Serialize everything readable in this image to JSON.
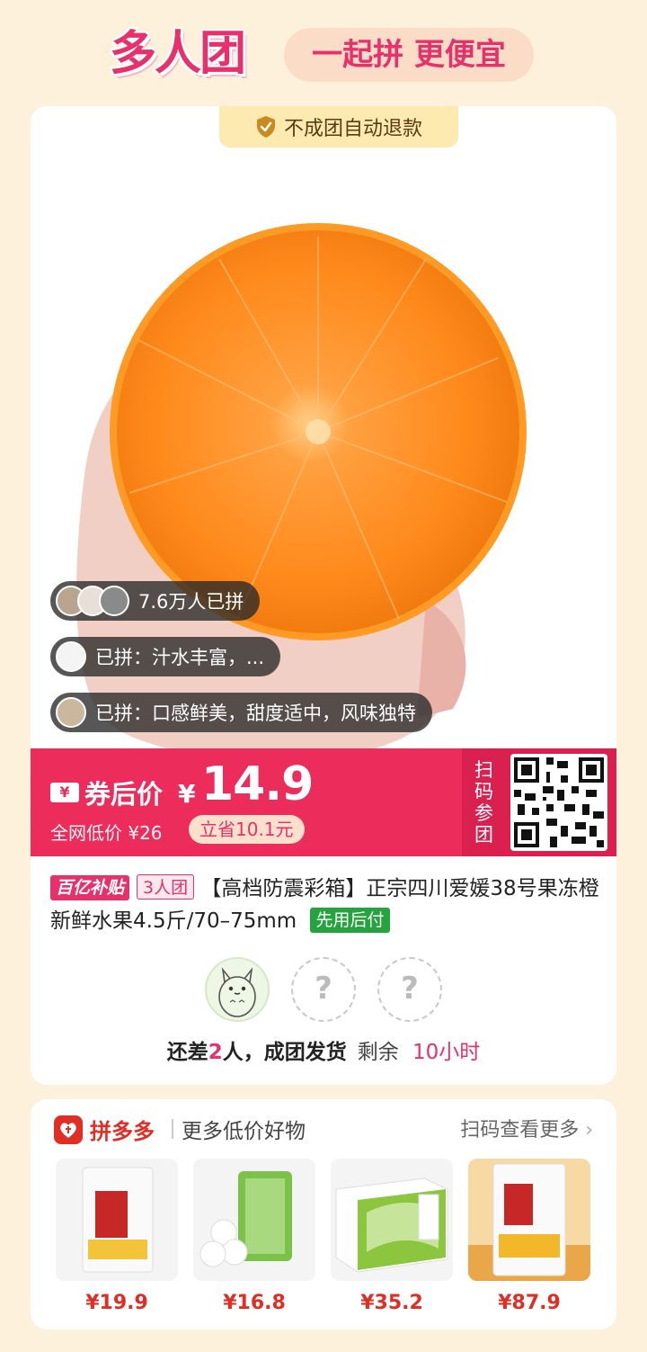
{
  "header": {
    "logo_text": "多人团",
    "slogan": "一起拼 更便宜"
  },
  "product": {
    "refund_badge": "不成团自动退款",
    "joined_count": "7.6万人已拼",
    "reviews": [
      "已拼：汁水丰富，...",
      "已拼：口感鲜美，甜度适中，风味独特"
    ],
    "coupon_icon": "¥",
    "price_label": "券后价",
    "currency": "¥",
    "price": "14.9",
    "original_price": "全网低价 ¥26",
    "saving": "立省10.1元",
    "scan_label": "扫码参团",
    "tag_subsidy": "百亿补贴",
    "tag_group": "3人团",
    "title": "【高档防震彩箱】正宗四川爱媛38号果冻橙新鲜水果4.5斤/70–75mm",
    "tag_pay_later": "先用后付"
  },
  "group": {
    "empty_slot": "?",
    "remaining_prefix": "还差",
    "remaining_count": "2",
    "remaining_suffix": "人，成团发货",
    "time_prefix": "剩余",
    "time_left": "10小时"
  },
  "recommend": {
    "brand": "拼多多",
    "subtitle": "更多低价好物",
    "scan_more": "扫码查看更多",
    "items": [
      {
        "price": "¥19.9"
      },
      {
        "price": "¥16.8"
      },
      {
        "price": "¥35.2"
      },
      {
        "price": "¥87.9"
      }
    ]
  },
  "colors": {
    "accent": "#e8306a",
    "price_bar": "#ec2d5c",
    "pdd_red": "#e02e24",
    "pay_green": "#24a33f",
    "background": "#fdf1dc"
  }
}
